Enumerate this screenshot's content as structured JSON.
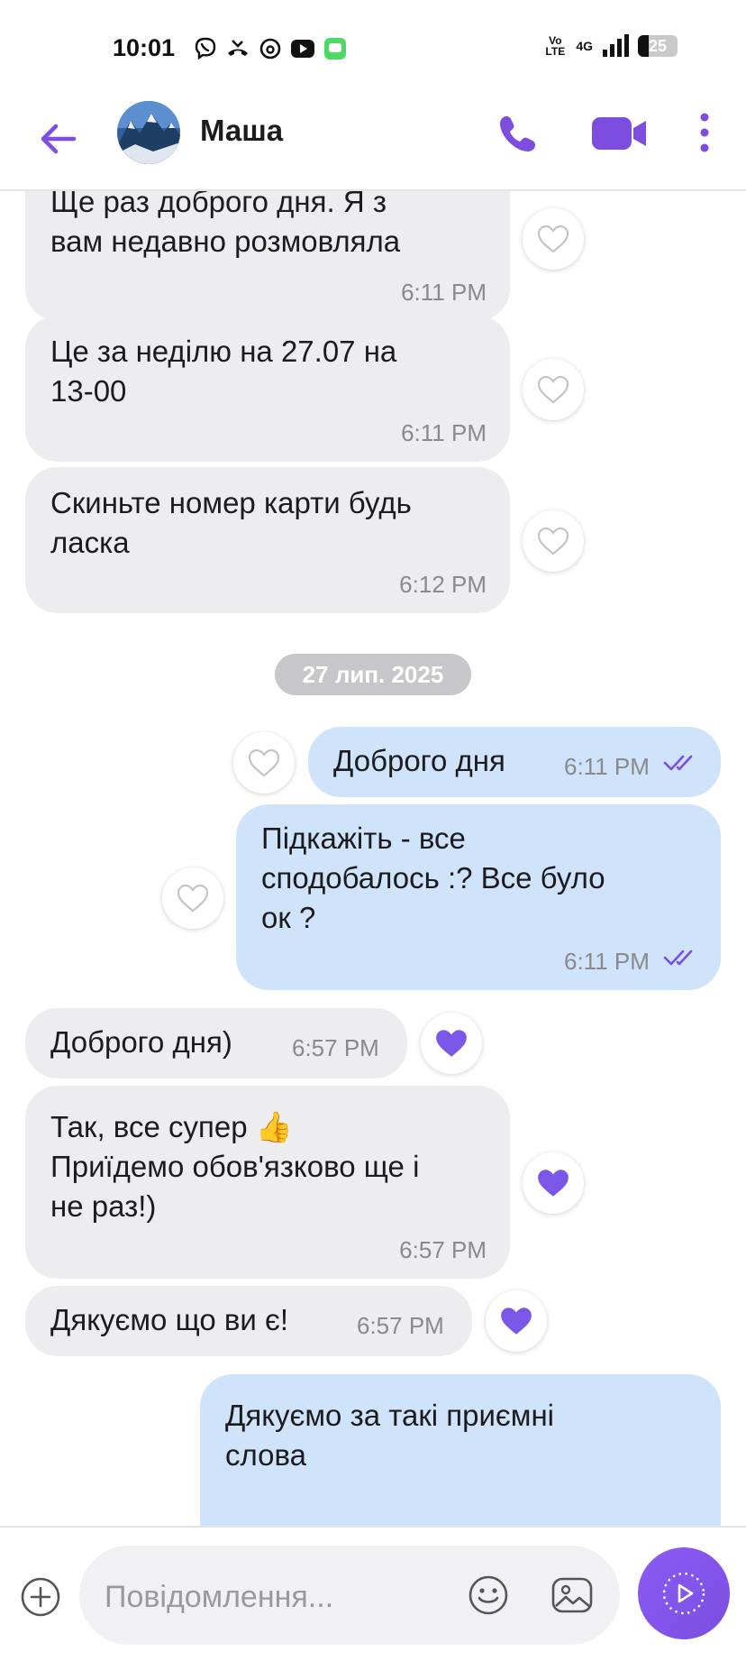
{
  "status_bar": {
    "time": "10:01",
    "app_icons": [
      "viber-icon",
      "missed-call-icon",
      "threads-icon",
      "youtube-icon",
      "messages-icon"
    ],
    "volte": "Vo LTE",
    "network": "4G",
    "battery": "25"
  },
  "header": {
    "contact_name": "Маша",
    "icons": [
      "back-arrow-icon",
      "phone-icon",
      "video-camera-icon",
      "more-vertical-icon"
    ],
    "accent_color": "#7c4ddf"
  },
  "messages": [
    {
      "direction": "in",
      "text": "Ще раз доброго дня. Я з\nвам недавно розмовляла",
      "time": "6:11 PM",
      "reaction": "none"
    },
    {
      "direction": "in",
      "text": "Це за неділю на 27.07 на\n13-00",
      "time": "6:11 PM",
      "reaction": "none"
    },
    {
      "direction": "in",
      "text": "Скиньте номер карти будь\nласка",
      "time": "6:12 PM",
      "reaction": "none"
    },
    {
      "direction": "date",
      "text": "27 лип. 2025"
    },
    {
      "direction": "out",
      "text": "Доброго дня",
      "time": "6:11 PM",
      "reaction": "none",
      "status": "read"
    },
    {
      "direction": "out",
      "text": "Підкажіть - все\nсподобалось :? Все було\nок ?",
      "time": "6:11 PM",
      "reaction": "none",
      "status": "read"
    },
    {
      "direction": "in",
      "text": "Доброго дня)",
      "time": "6:57 PM",
      "reaction": "heart"
    },
    {
      "direction": "in",
      "text": "Так, все супер 👍\nПриїдемо обов'язково ще і\nне раз!)",
      "time": "6:57 PM",
      "reaction": "heart"
    },
    {
      "direction": "in",
      "text": "Дякуємо що ви є!",
      "time": "6:57 PM",
      "reaction": "heart"
    },
    {
      "direction": "out",
      "text": "Дякуємо за такі приємні\nслова",
      "reaction": "none"
    }
  ],
  "input": {
    "placeholder": "Повідомлення...",
    "icons": [
      "plus-icon",
      "emoji-icon",
      "gallery-icon",
      "send-icon"
    ]
  },
  "colors": {
    "incoming_bubble": "#ededef",
    "outgoing_bubble": "#cfe3fb",
    "heart_filled": "#7b57e8",
    "date_chip": "#c7c7c9"
  }
}
